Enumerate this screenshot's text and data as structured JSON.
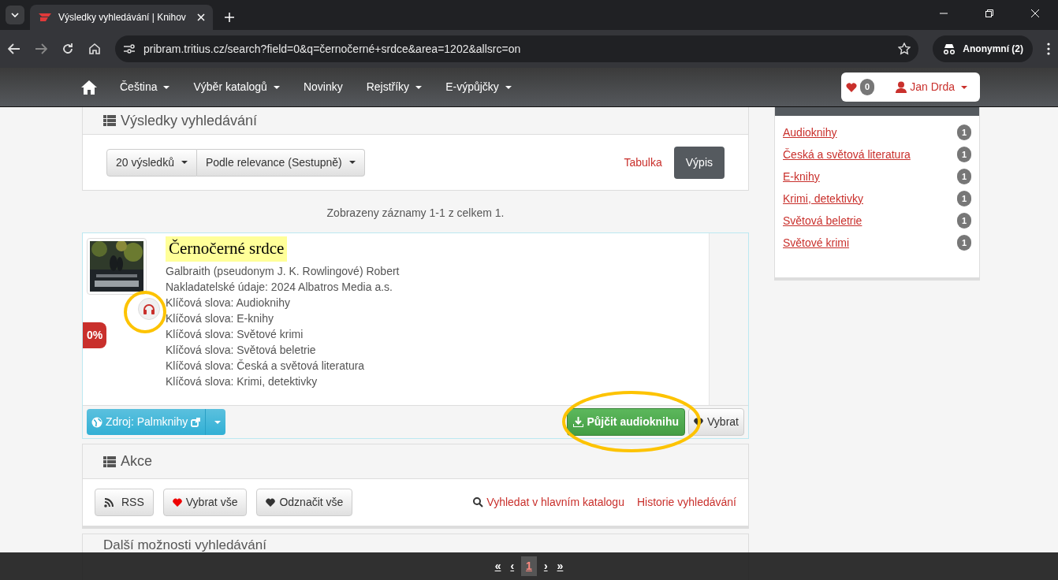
{
  "browser": {
    "tab_title": "Výsledky vyhledávání | Knihov",
    "url": "pribram.tritius.cz/search?field=0&q=černočerné+srdce&area=1202&allsrc=on",
    "profile": "Anonymní (2)"
  },
  "navbar": {
    "items": [
      {
        "label": "Čeština",
        "dropdown": true
      },
      {
        "label": "Výběr katalogů",
        "dropdown": true
      },
      {
        "label": "Novinky",
        "dropdown": false
      },
      {
        "label": "Rejstříky",
        "dropdown": true
      },
      {
        "label": "E-výpůjčky",
        "dropdown": true
      }
    ],
    "favorites_count": "0",
    "user": "Jan Drda"
  },
  "results": {
    "title": "Výsledky vyhledávání",
    "count_select": "20 výsledků",
    "sort_select": "Podle relevance (Sestupně)",
    "views": [
      {
        "label": "Tabulka",
        "selected": false
      },
      {
        "label": "Výpis",
        "selected": true
      }
    ],
    "summary": "Zobrazeny záznamy 1-1 z celkem 1."
  },
  "record": {
    "title": "Černočerné srdce",
    "badge": "0%",
    "lines": [
      "Galbraith (pseudonym J. K. Rowlingové) Robert",
      "Nakladatelské údaje: 2024 Albatros Media a.s.",
      "Klíčová slova: Audioknihy",
      "Klíčová slova: E-knihy",
      "Klíčová slova: Světové krimi",
      "Klíčová slova: Světová beletrie",
      "Klíčová slova: Česká a světová literatura",
      "Klíčová slova: Krimi, detektivky"
    ],
    "source": "Zdroj: Palmknihy",
    "borrow": "Půjčit audioknihu",
    "select": "Vybrat"
  },
  "actions": {
    "title": "Akce",
    "buttons": [
      {
        "label": "RSS",
        "kind": "rss"
      },
      {
        "label": "Vybrat vše",
        "kind": "select"
      },
      {
        "label": "Odznačit vše",
        "kind": "unselect"
      }
    ],
    "links": [
      {
        "label": "Vyhledat v hlavním katalogu",
        "kind": "search"
      },
      {
        "label": "Historie vyhledávání",
        "kind": "plain"
      }
    ]
  },
  "more": {
    "title": "Další možnosti vyhledávání"
  },
  "facets": [
    {
      "label": "Audioknihy",
      "count": "1"
    },
    {
      "label": "Česká a světová literatura",
      "count": "1"
    },
    {
      "label": "E-knihy",
      "count": "1"
    },
    {
      "label": "Krimi, detektivky",
      "count": "1"
    },
    {
      "label": "Světová beletrie",
      "count": "1"
    },
    {
      "label": "Světové krimi",
      "count": "1"
    }
  ],
  "pager": {
    "first": "«",
    "prev": "‹",
    "pages": [
      {
        "label": "1",
        "selected": true
      }
    ],
    "next": "›",
    "last": "»"
  }
}
